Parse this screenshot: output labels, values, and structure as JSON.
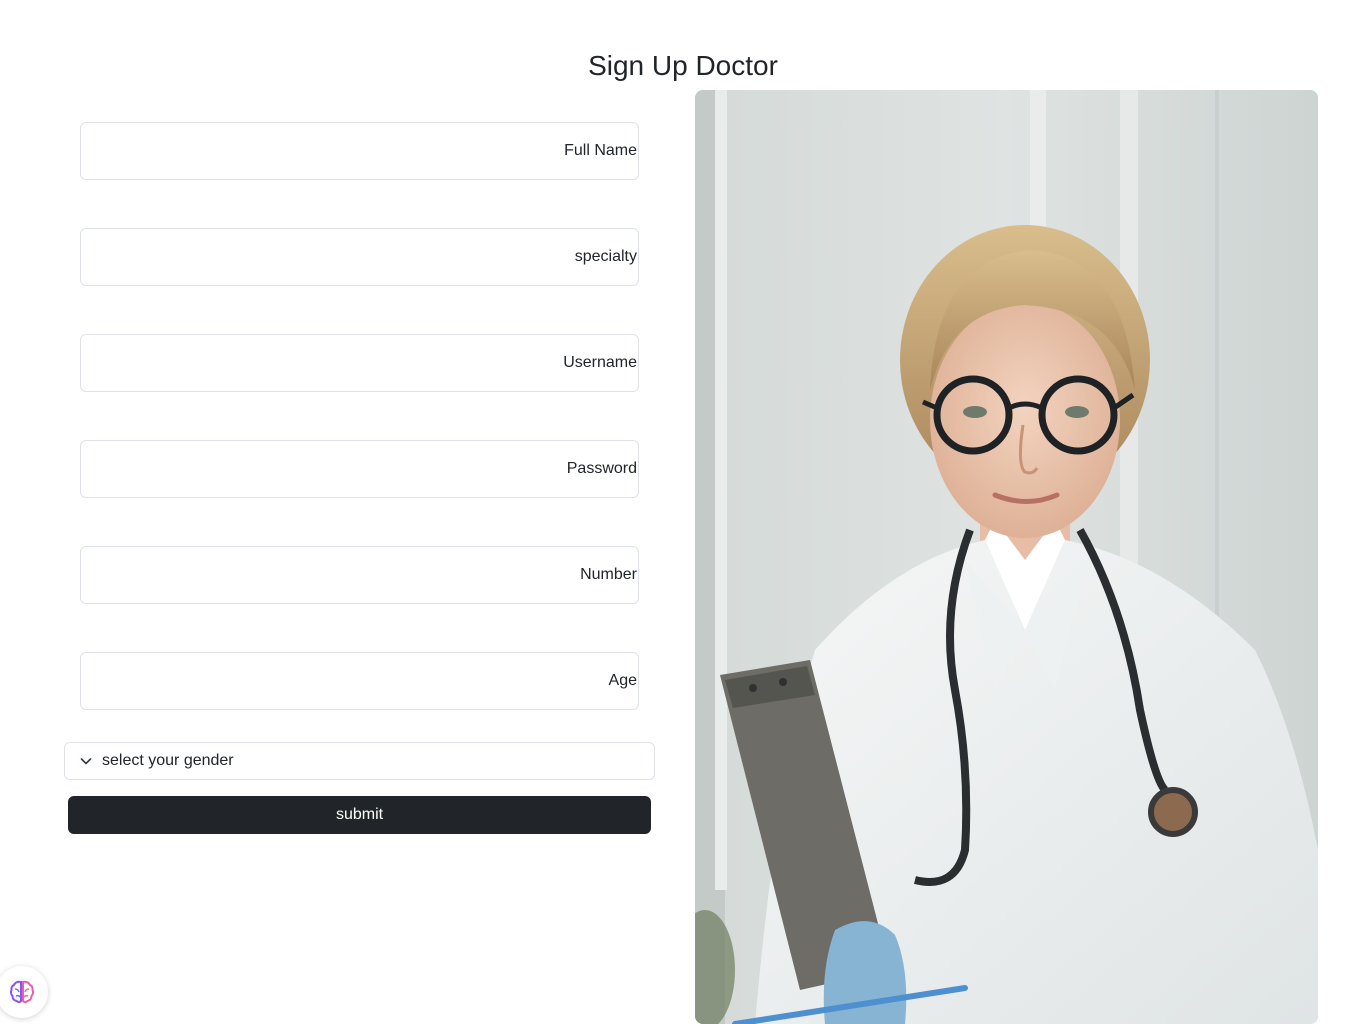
{
  "page": {
    "title": "Sign Up Doctor"
  },
  "form": {
    "fields": [
      {
        "name": "full-name-field",
        "label": "Full Name",
        "value": ""
      },
      {
        "name": "specialty-field",
        "label": "specialty",
        "value": ""
      },
      {
        "name": "username-field",
        "label": "Username",
        "value": ""
      },
      {
        "name": "password-field",
        "label": "Password",
        "value": ""
      },
      {
        "name": "number-field",
        "label": "Number",
        "value": ""
      },
      {
        "name": "age-field",
        "label": "Age",
        "value": ""
      }
    ],
    "gender_select": {
      "selected": "select your gender"
    },
    "submit_label": "submit"
  },
  "image": {
    "subject": "doctor-portrait",
    "icon": "photo"
  },
  "widget": {
    "icon": "brain-icon"
  },
  "colors": {
    "button_bg": "#212529",
    "button_text": "#ffffff",
    "border": "#dee2e6"
  }
}
